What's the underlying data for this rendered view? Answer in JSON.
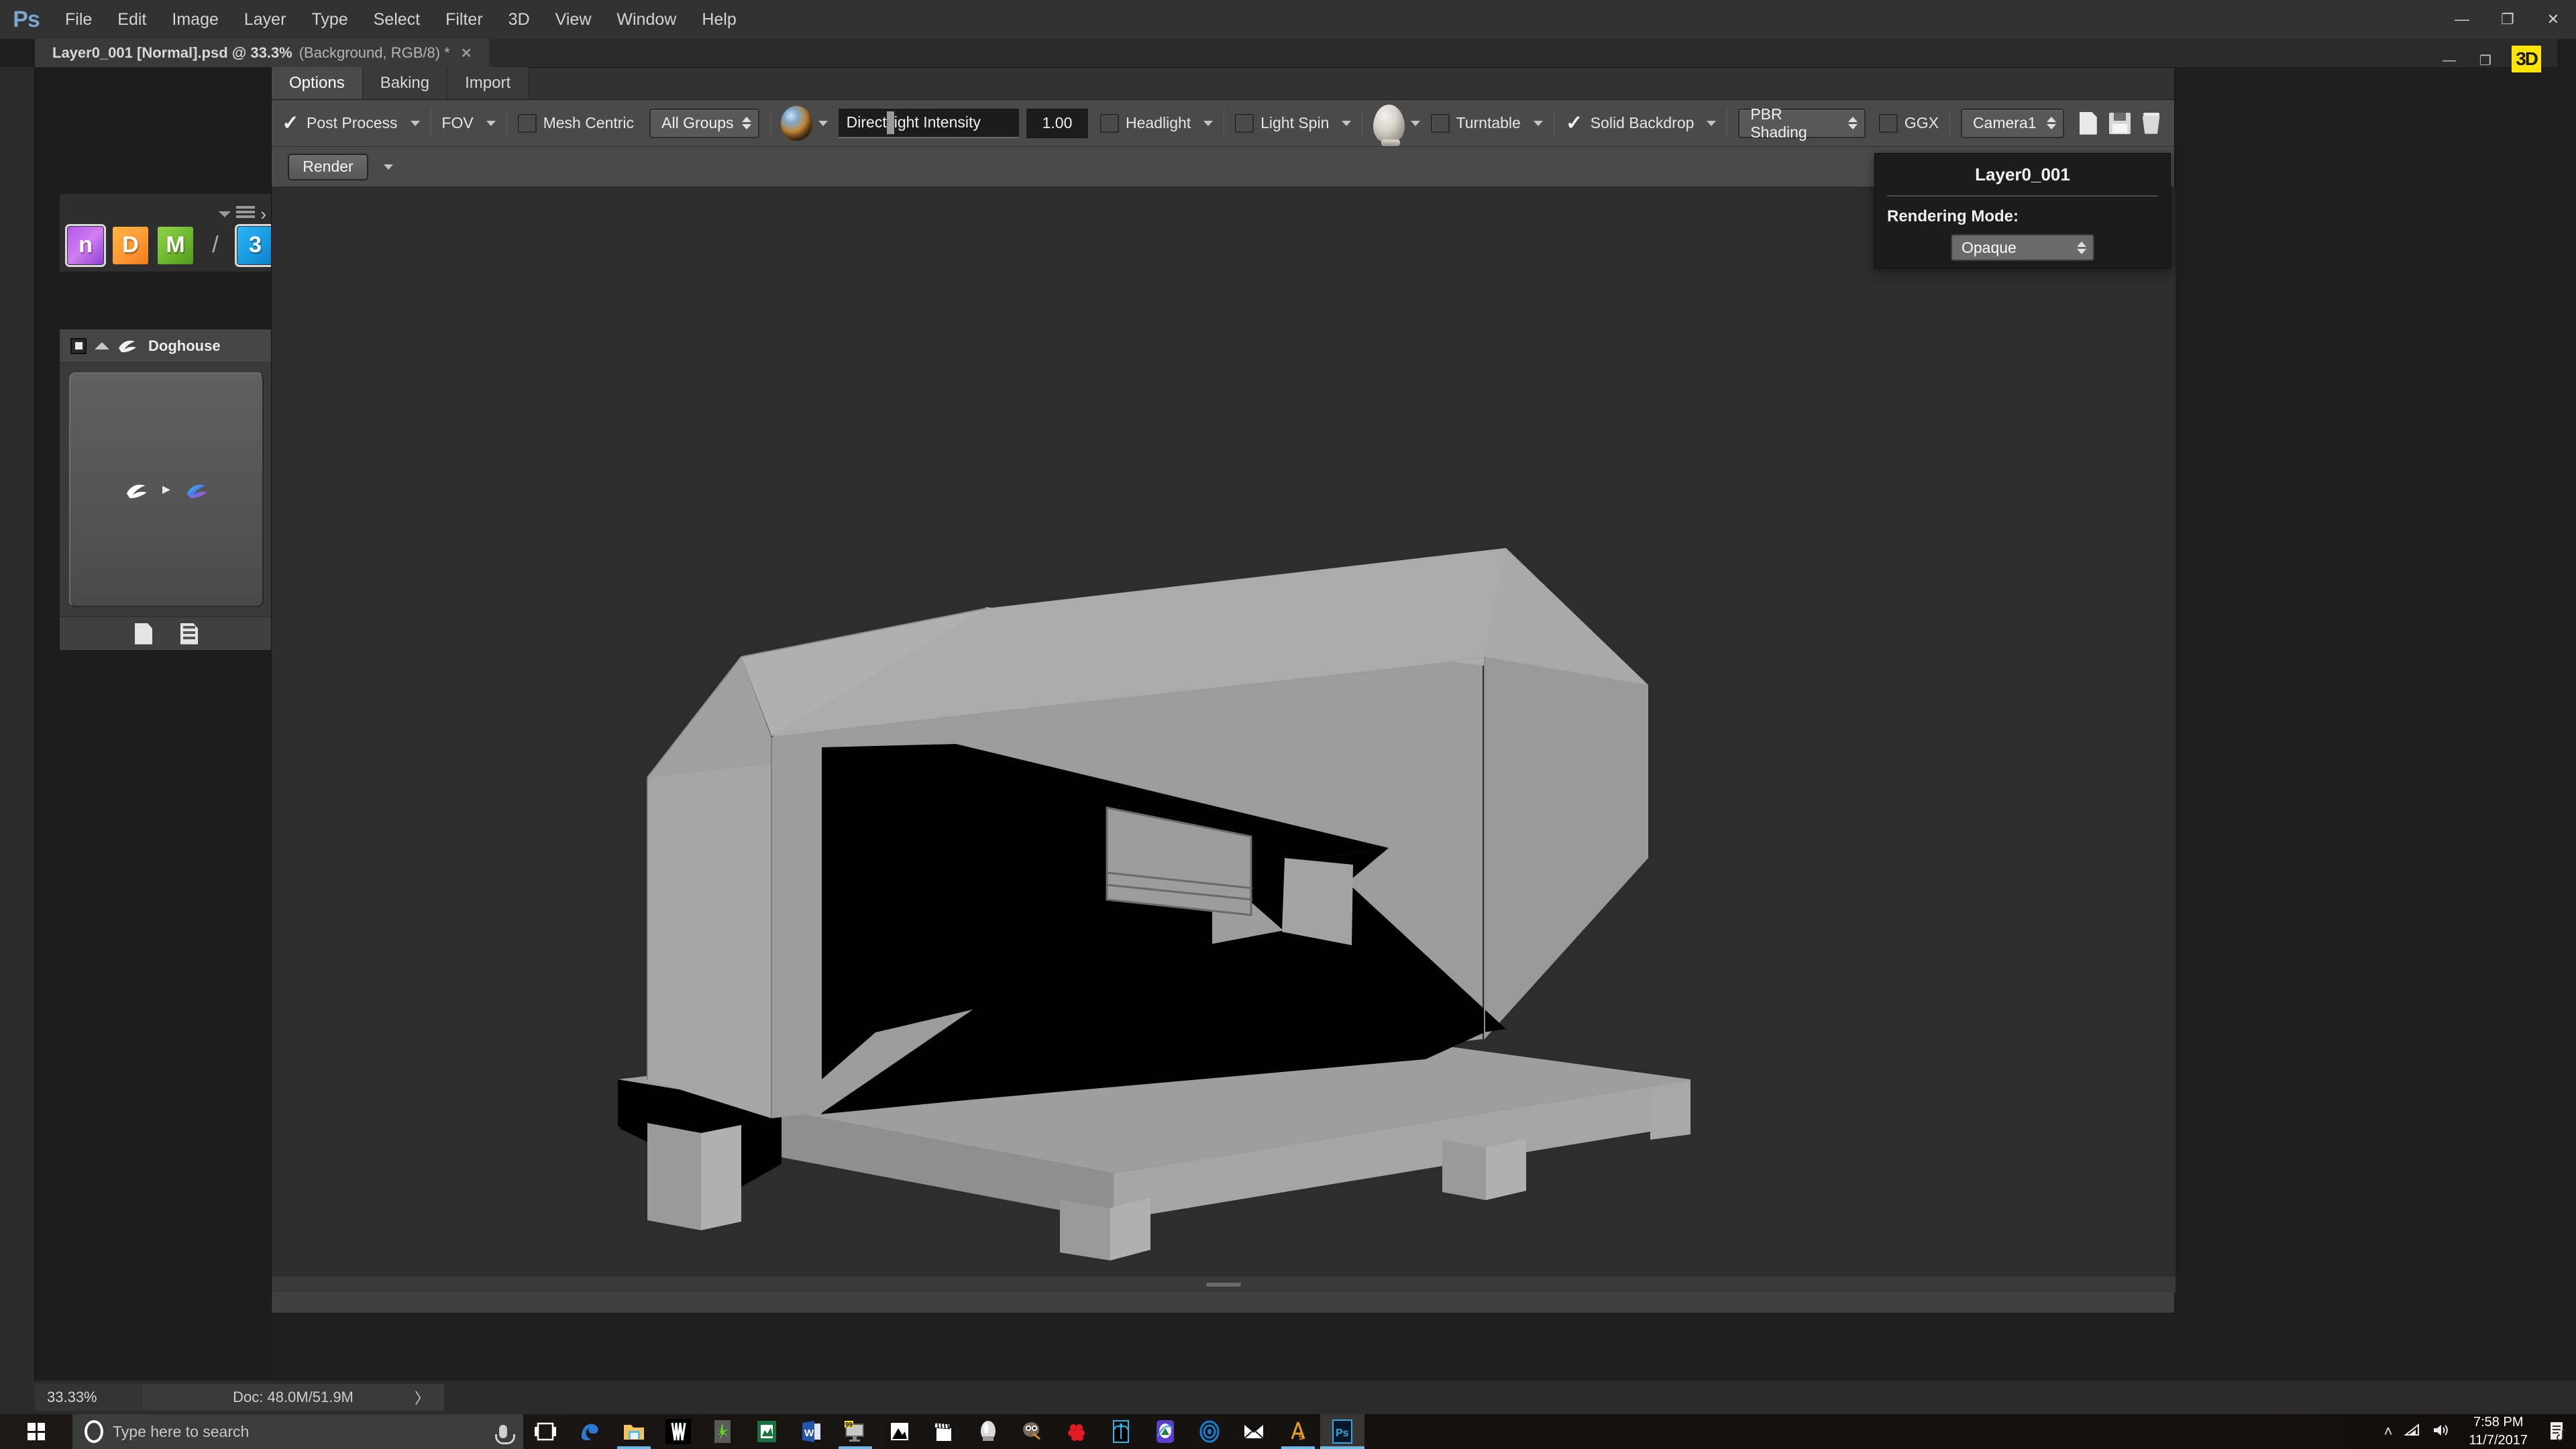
{
  "app": {
    "name": "Adobe Photoshop",
    "logo_text": "Ps"
  },
  "menubar": {
    "items": [
      "File",
      "Edit",
      "Image",
      "Layer",
      "Type",
      "Select",
      "Filter",
      "3D",
      "View",
      "Window",
      "Help"
    ]
  },
  "window_controls": {
    "minimize": "—",
    "maximize": "❐",
    "close": "✕"
  },
  "document": {
    "tab_title": "Layer0_001 [Normal].psd @ 33.3%",
    "tab_suffix": "(Background, RGB/8) *",
    "tab_close": "✕"
  },
  "ps_window_buttons": {
    "minimize": "—",
    "restore": "❐",
    "badge": "3D"
  },
  "quixel": {
    "panel_menu_icon": "hamburger-icon",
    "expand_icon": "›",
    "icons": [
      {
        "name": "ndo-icon",
        "glyph": "n",
        "selected": true
      },
      {
        "name": "ddo-icon",
        "glyph": "D",
        "selected": false
      },
      {
        "name": "mdo-icon",
        "glyph": "M",
        "selected": false
      },
      {
        "name": "separator",
        "glyph": "/",
        "selected": false
      },
      {
        "name": "3do-icon",
        "glyph": "3",
        "selected": true
      }
    ]
  },
  "layer_panel": {
    "title": "Doghouse",
    "footer_icons": [
      "new-document-icon",
      "duplicate-document-icon"
    ]
  },
  "threedo": {
    "tabs": [
      {
        "label": "Options",
        "active": true
      },
      {
        "label": "Baking",
        "active": false
      },
      {
        "label": "Import",
        "active": false
      }
    ],
    "toolbar": {
      "post_process": {
        "label": "Post Process",
        "checked": true
      },
      "fov": {
        "label": "FOV"
      },
      "mesh_centric": {
        "label": "Mesh Centric",
        "checked": false
      },
      "groups_select": {
        "value": "All Groups"
      },
      "material_preview": "material-ball-icon",
      "light_intensity_field": {
        "value": "Direct Light Intensity"
      },
      "light_intensity_value": "1.00",
      "headlight": {
        "label": "Headlight",
        "checked": false
      },
      "light_spin": {
        "label": "Light Spin",
        "checked": false
      },
      "mesh_preview": "mesh-preview-icon",
      "turntable": {
        "label": "Turntable",
        "checked": false
      },
      "solid_backdrop": {
        "label": "Solid Backdrop",
        "checked": true
      },
      "shading_select": {
        "value": "PBR Shading"
      },
      "ggx": {
        "label": "GGX",
        "checked": false
      },
      "camera_select": {
        "value": "Camera1"
      },
      "action_icons": [
        "new-preset-icon",
        "save-preset-icon",
        "delete-preset-icon"
      ]
    },
    "render_button": "Render"
  },
  "layer_flyout": {
    "title": "Layer0_001",
    "rendering_mode_label": "Rendering Mode:",
    "rendering_mode_value": "Opaque"
  },
  "statusbar": {
    "zoom": "33.33%",
    "doc_info": "Doc: 48.0M/51.9M",
    "expand_icon": "〉"
  },
  "taskbar": {
    "start_icon": "windows-logo-icon",
    "search_placeholder": "Type here to search",
    "apps": [
      {
        "name": "task-view-icon",
        "running": false
      },
      {
        "name": "edge-browser-icon",
        "running": false
      },
      {
        "name": "file-explorer-icon",
        "running": true
      },
      {
        "name": "corsair-icon",
        "running": false
      },
      {
        "name": "razer-icon",
        "running": false
      },
      {
        "name": "excel-icon",
        "running": false
      },
      {
        "name": "word-icon",
        "running": false
      },
      {
        "name": "display-monitor-icon",
        "running": true
      },
      {
        "name": "photos-icon",
        "running": false
      },
      {
        "name": "movie-maker-icon",
        "running": false
      },
      {
        "name": "sculptris-pro-icon",
        "running": false
      },
      {
        "name": "gimp-icon",
        "running": false
      },
      {
        "name": "raspberry-icon",
        "running": false
      },
      {
        "name": "palm-tree-icon",
        "running": false
      },
      {
        "name": "purple-app-icon",
        "running": false
      },
      {
        "name": "spiral-icon",
        "running": false
      },
      {
        "name": "mail-icon",
        "running": false
      },
      {
        "name": "game-emblem-icon",
        "running": true
      },
      {
        "name": "photoshop-icon",
        "running": true,
        "active": true
      }
    ],
    "tray": {
      "chevron": "˄",
      "network_icon": "wifi-icon",
      "volume_icon": "speaker-icon",
      "time": "7:58 PM",
      "date": "11/7/2017",
      "action_center_icon": "notifications-icon"
    }
  },
  "viewport": {
    "model_name": "doghouse-3d-model",
    "background_color": "#2d2d2d",
    "model_color": "#9a9a9a"
  },
  "colors": {
    "menubar_bg": "#323232",
    "panel_bg": "#4a4a4a",
    "viewport_bg": "#2d2d2d",
    "accent": "#6fb7e8",
    "badge_yellow": "#ffe400",
    "ps_blue": "#7ba7cc"
  }
}
